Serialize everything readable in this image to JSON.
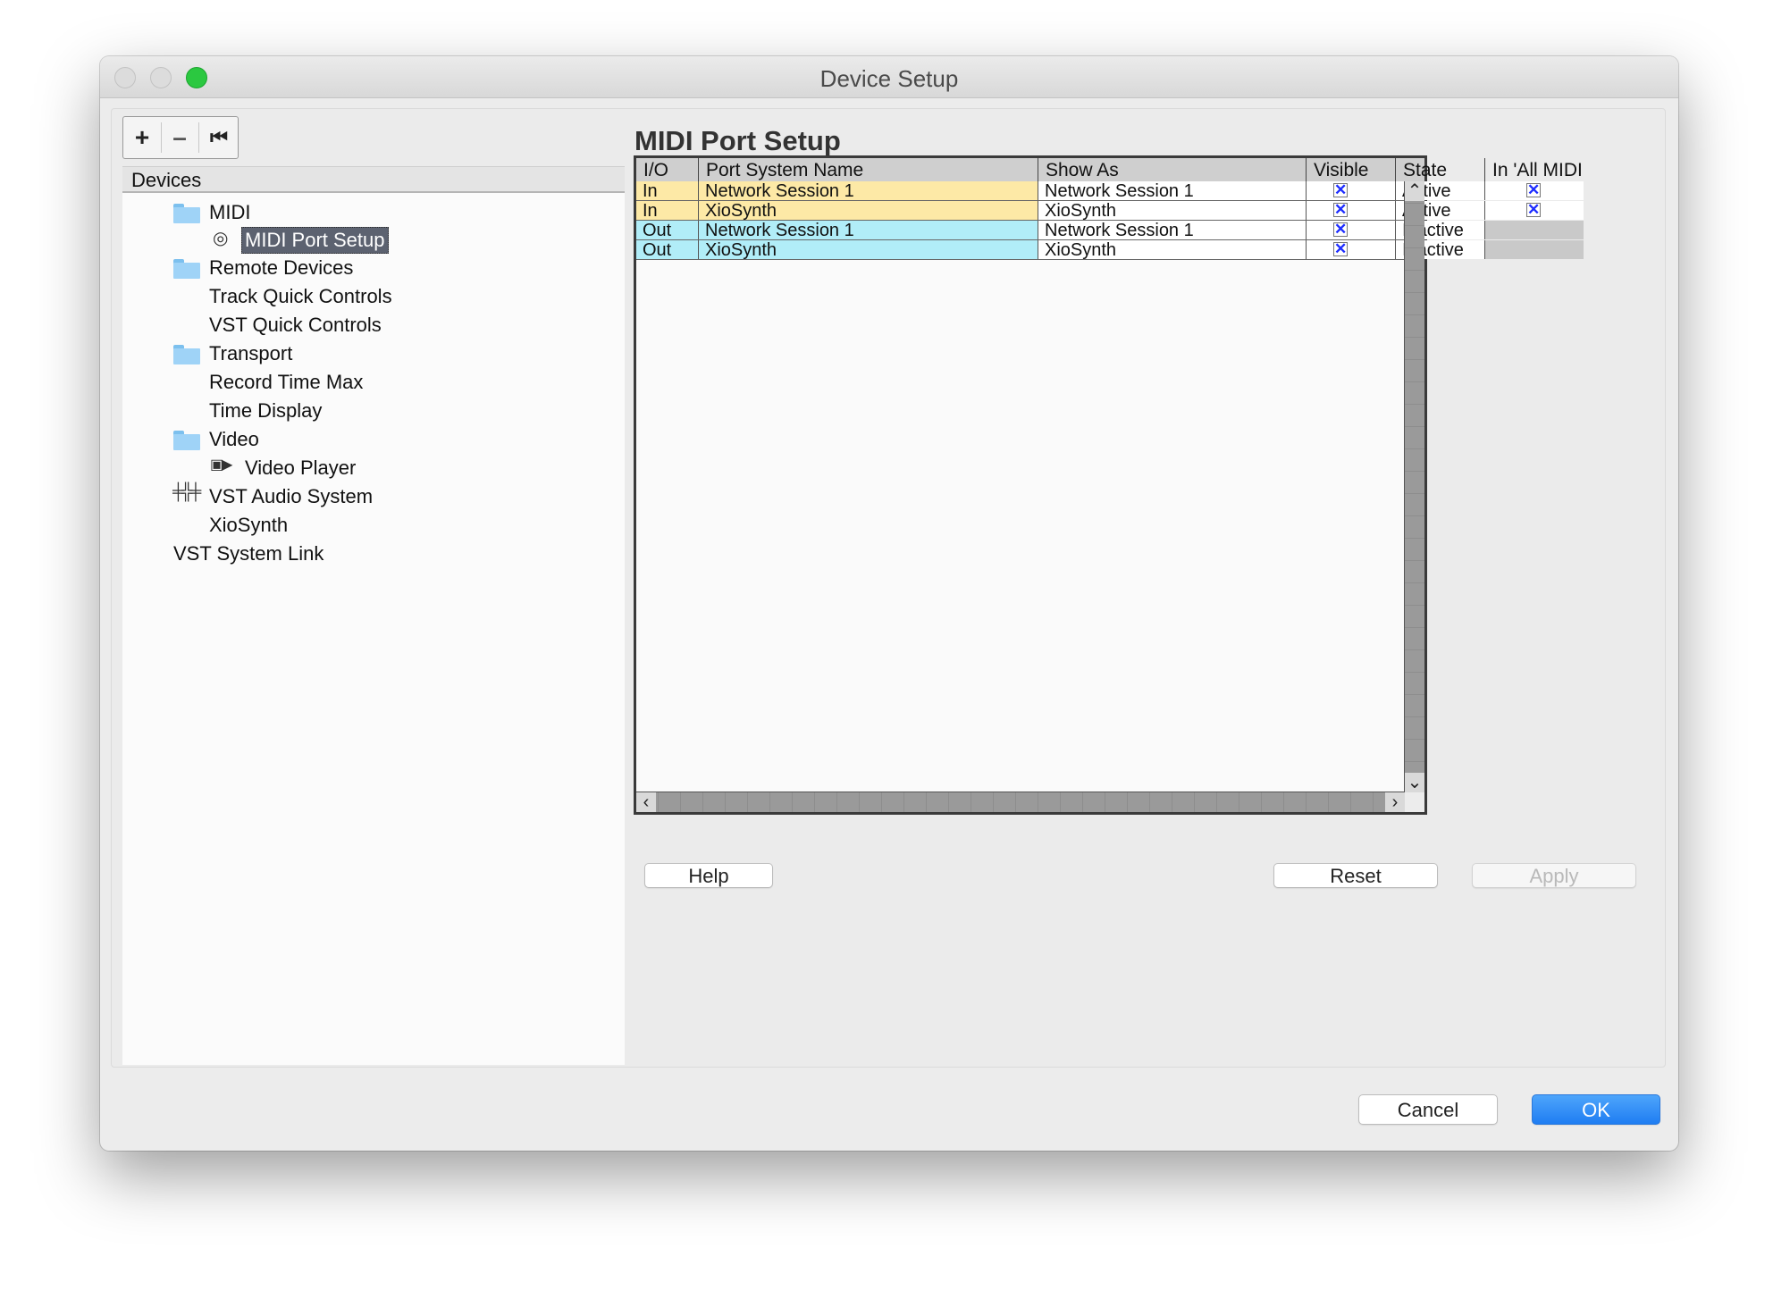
{
  "window": {
    "title": "Device Setup"
  },
  "toolbar": {
    "add": "+",
    "remove": "–",
    "reset": "⏮"
  },
  "devices": {
    "header": "Devices",
    "items": [
      {
        "label": "MIDI",
        "icon": "folder-icon"
      },
      {
        "label": "MIDI Port Setup",
        "icon": "midi-port-icon",
        "selected": true
      },
      {
        "label": "Remote Devices",
        "icon": "folder-icon"
      },
      {
        "label": "Track Quick Controls",
        "icon": ""
      },
      {
        "label": "VST Quick Controls",
        "icon": ""
      },
      {
        "label": "Transport",
        "icon": "folder-icon"
      },
      {
        "label": "Record Time Max",
        "icon": ""
      },
      {
        "label": "Time Display",
        "icon": ""
      },
      {
        "label": "Video",
        "icon": "folder-icon"
      },
      {
        "label": "Video Player",
        "icon": "video-icon"
      },
      {
        "label": "VST Audio System",
        "icon": "audio-system-icon"
      },
      {
        "label": "XioSynth",
        "icon": ""
      },
      {
        "label": "VST System Link",
        "icon": ""
      }
    ]
  },
  "panel": {
    "title": "MIDI Port Setup",
    "columns": [
      "I/O",
      "Port System Name",
      "Show As",
      "Visible",
      "State",
      "In 'All MIDI Inputs'"
    ],
    "rows": [
      {
        "io": "In",
        "port": "Network Session 1",
        "show_as": "Network Session 1",
        "visible": "✕",
        "state": "Active",
        "all_midi": "✕",
        "color": "#fde9a6"
      },
      {
        "io": "In",
        "port": "XioSynth",
        "show_as": "XioSynth",
        "visible": "✕",
        "state": "Active",
        "all_midi": "✕",
        "color": "#fde9a6"
      },
      {
        "io": "Out",
        "port": "Network Session 1",
        "show_as": "Network Session 1",
        "visible": "✕",
        "state": "Inactive",
        "all_midi": "",
        "color": "#b1edf8"
      },
      {
        "io": "Out",
        "port": "XioSynth",
        "show_as": "XioSynth",
        "visible": "✕",
        "state": "Inactive",
        "all_midi": "",
        "color": "#b1edf8"
      }
    ],
    "scroll": {
      "up": "⌃",
      "down": "⌄",
      "left": "‹",
      "right": "›"
    }
  },
  "buttons": {
    "help": "Help",
    "reset": "Reset",
    "apply": "Apply",
    "cancel": "Cancel",
    "ok": "OK"
  }
}
